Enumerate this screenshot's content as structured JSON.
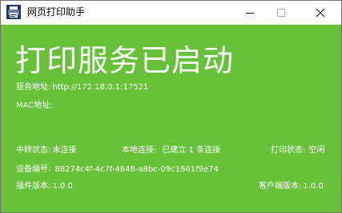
{
  "window": {
    "title": "网页打印助手",
    "icon": "printer-app-icon",
    "controls": [
      "minimize-icon",
      "maximize-icon",
      "close-icon"
    ]
  },
  "main": {
    "headline": "打印服务已启动",
    "service_address": {
      "label": "服务地址:",
      "value": "http://172.18.0.1:17521"
    },
    "mac_address": {
      "label": "MAC地址:",
      "value": ""
    },
    "relay_status": {
      "label": "中转状态:",
      "value": "未连接"
    },
    "local_connection": {
      "label": "本地连接:",
      "value": "已建立 1 条连接"
    },
    "print_status": {
      "label": "打印状态:",
      "value": "空闲"
    },
    "device_id": {
      "label": "设备编号:",
      "value": "88274c4f-4c7f-4848-a8bc-09c1661f9e74"
    },
    "plugin_version": {
      "label": "插件版本:",
      "value": "1.0.0"
    },
    "client_version": {
      "label": "客户端版本:",
      "value": "1.0.0"
    }
  },
  "colors": {
    "background": "#67c23a",
    "text": "#ffffff",
    "titlebar": "#ffffff"
  }
}
